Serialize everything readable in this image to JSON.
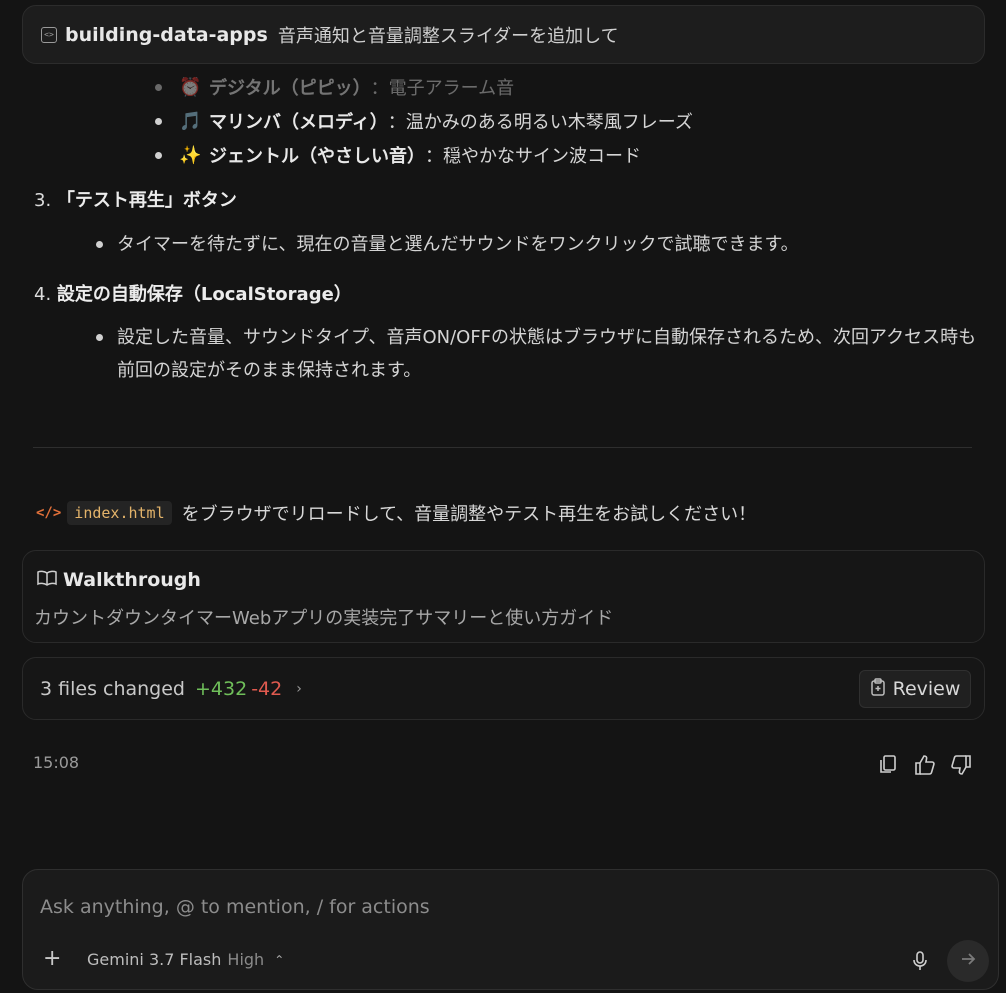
{
  "header": {
    "repo": "building-data-apps",
    "message": "音声通知と音量調整スライダーを追加して"
  },
  "sound_list": [
    {
      "icon": "alarm-clock-icon",
      "emoji": "⏰",
      "name": "デジタル（ピピッ）",
      "desc": "：電子アラーム音"
    },
    {
      "icon": "musical-note-icon",
      "emoji": "🎵",
      "name": "マリンバ（メロディ）",
      "desc": "：温かみのある明るい木琴風フレーズ"
    },
    {
      "icon": "sparkles-icon",
      "emoji": "✨",
      "name": "ジェントル（やさしい音）",
      "desc": "：穏やかなサイン波コード"
    }
  ],
  "sections": [
    {
      "num": "3.",
      "title": "「テスト再生」ボタン",
      "bullets": [
        "タイマーを待たずに、現在の音量と選んだサウンドをワンクリックで試聴できます。"
      ]
    },
    {
      "num": "4.",
      "title": "設定の自動保存（LocalStorage）",
      "bullets": [
        "設定した音量、サウンドタイプ、音声ON/OFFの状態はブラウザに自動保存されるため、次回アクセス時も",
        "前回の設定がそのまま保持されます。"
      ]
    }
  ],
  "reload": {
    "file": "index.html",
    "text": "をブラウザでリロードして、音量調整やテスト再生をお試しください！"
  },
  "walkthrough": {
    "title": "Walkthrough",
    "desc": "カウントダウンタイマーWebアプリの実装完了サマリーと使い方ガイド"
  },
  "files": {
    "label": "3 files changed",
    "added": "+432",
    "removed": "-42",
    "review": "Review"
  },
  "message_time": "15:08",
  "composer": {
    "placeholder": "Ask anything, @ to mention, / for actions",
    "model": "Gemini 3.7 Flash",
    "level": "High"
  },
  "colors": {
    "background": "#141414",
    "added": "#6fbf5a",
    "removed": "#e05a4f",
    "code_file": "#e3b36a"
  }
}
